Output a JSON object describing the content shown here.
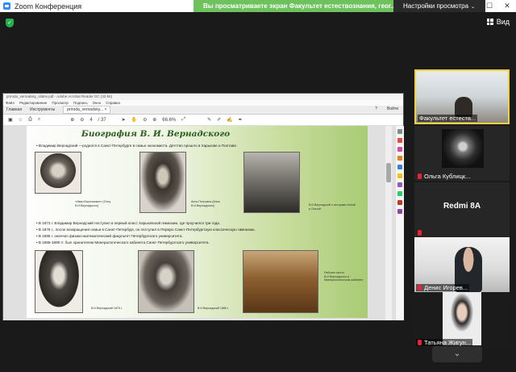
{
  "window": {
    "title": "Zoom Конференция",
    "minimize": "—",
    "maximize": "☐",
    "close": "✕"
  },
  "share": {
    "message": "Вы просматриваете экран Факультет естествознания, геог...",
    "settings_label": "Настройки просмотра ⌄"
  },
  "top": {
    "view_label": "Вид"
  },
  "acrobat": {
    "title": "priroda_vernadsky_slides.pdf - Adobe Acrobat Reader DC (32-bit)",
    "menu": [
      "Файл",
      "Редактирование",
      "Просмотр",
      "Подпись",
      "Окно",
      "Справка"
    ],
    "tabs": [
      "Главная",
      "Инструменты"
    ],
    "doc_tab": "priroda_vernadsky... ×",
    "help": "?",
    "signin": "Войти",
    "page_current": "4",
    "page_total": "/ 37",
    "zoom": "66.6%"
  },
  "slide": {
    "title": "Биография В. И. Вернадского",
    "intro": "•  Владимир Вернадский —родился в Санкт-Петербурге в семье экономиста. Детство прошло в Харькове и Полтаве.",
    "captions": [
      "«Иван Васильевич» (Отец В.И.Вернадского)",
      "Анна Петровна (Мать В.И.Вернадского)",
      "В.И.Вернадский с сестрами Анной и Ольгой"
    ],
    "bullets": [
      "•  В 1873 г. Владимир Вернадский поступил в первый класс Харьковской гимназии, где проучился три года.",
      "•  В 1876 г., после возвращения семьи в Санкт-Петербург, он поступил в Первую Санкт-Петербургскую классическую гимназию.",
      "•  В 1885 г. окончил физико-математический факультет Петербургского университета.",
      "•  В 1885-1890 гг. был хранителем Минералогического кабинета Санкт-Петербургского университета."
    ],
    "captions2": [
      "В.И.Вернадский 1875 г.",
      "В.И.Вернадский 1886 г.",
      "Рабочее место В.И.Вернадского в Минералогическом кабинете"
    ]
  },
  "participants": [
    {
      "name": "Факультет естеств..."
    },
    {
      "name": "Ольга Кублицк..."
    },
    {
      "name": "Redmi 8A"
    },
    {
      "name": "Денис Игорев..."
    },
    {
      "name": "Татьяна Жигун..."
    }
  ],
  "scroll_more": "⌄"
}
